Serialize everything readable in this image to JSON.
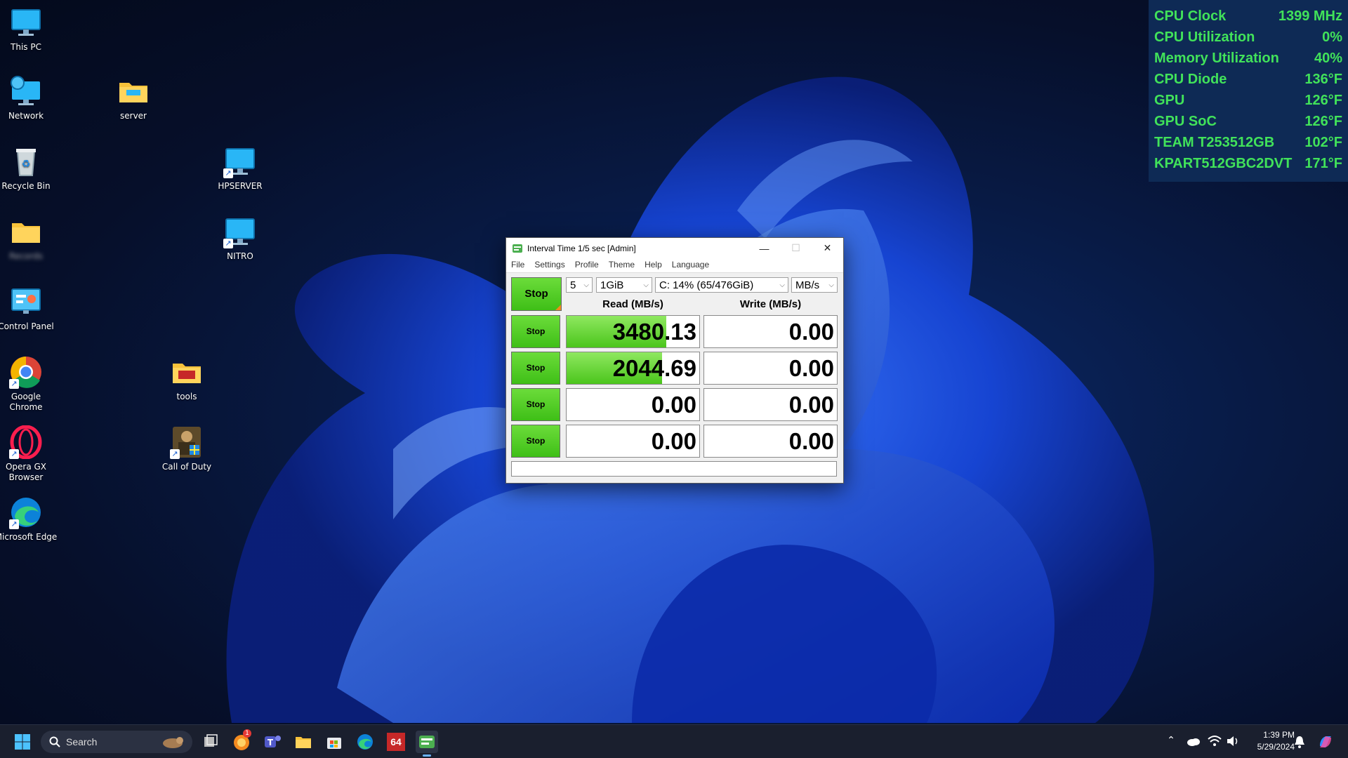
{
  "desktop_icons": [
    {
      "label": "This PC",
      "icon": "monitor-icon"
    },
    {
      "label": "Network",
      "icon": "network-icon"
    },
    {
      "label": "Recycle Bin",
      "icon": "recycle-bin-icon"
    },
    {
      "label": "Records",
      "icon": "folder-icon"
    },
    {
      "label": "Control Panel",
      "icon": "control-panel-icon"
    },
    {
      "label": "Google Chrome",
      "icon": "chrome-icon"
    },
    {
      "label": "Opera GX Browser",
      "icon": "opera-gx-icon"
    },
    {
      "label": "Microsoft Edge",
      "icon": "edge-icon"
    },
    {
      "label": "server",
      "icon": "folder-icon"
    },
    {
      "label": "HPSERVER",
      "icon": "monitor-icon"
    },
    {
      "label": "NITRO",
      "icon": "monitor-icon"
    },
    {
      "label": "tools",
      "icon": "folder-icon"
    },
    {
      "label": "Call of Duty",
      "icon": "call-of-duty-icon"
    }
  ],
  "sensors": [
    {
      "name": "CPU Clock",
      "value": "1399 MHz"
    },
    {
      "name": "CPU Utilization",
      "value": "0%"
    },
    {
      "name": "Memory Utilization",
      "value": "40%"
    },
    {
      "name": "CPU Diode",
      "value": "136°F"
    },
    {
      "name": "GPU",
      "value": "126°F"
    },
    {
      "name": "GPU SoC",
      "value": "126°F"
    },
    {
      "name": "TEAM T253512GB",
      "value": "102°F"
    },
    {
      "name": "KPART512GBC2DVT",
      "value": "171°F"
    }
  ],
  "window": {
    "title": "Interval Time 1/5 sec [Admin]",
    "menu": [
      "File",
      "Settings",
      "Profile",
      "Theme",
      "Help",
      "Language"
    ],
    "main_stop": "Stop",
    "count": "5",
    "size": "1GiB",
    "drive": "C: 14% (65/476GiB)",
    "unit": "MB/s",
    "read_header": "Read (MB/s)",
    "write_header": "Write (MB/s)",
    "rows": [
      {
        "stop": "Stop",
        "read": "3480.13",
        "write": "0.00",
        "read_fill": 0.75
      },
      {
        "stop": "Stop",
        "read": "2044.69",
        "write": "0.00",
        "read_fill": 0.72
      },
      {
        "stop": "Stop",
        "read": "0.00",
        "write": "0.00",
        "read_fill": 0
      },
      {
        "stop": "Stop",
        "read": "0.00",
        "write": "0.00",
        "read_fill": 0
      }
    ]
  },
  "taskbar": {
    "search_placeholder": "Search",
    "aida_label": "64",
    "time": "1:39 PM",
    "date": "5/29/2024",
    "notification_badge": "1"
  }
}
